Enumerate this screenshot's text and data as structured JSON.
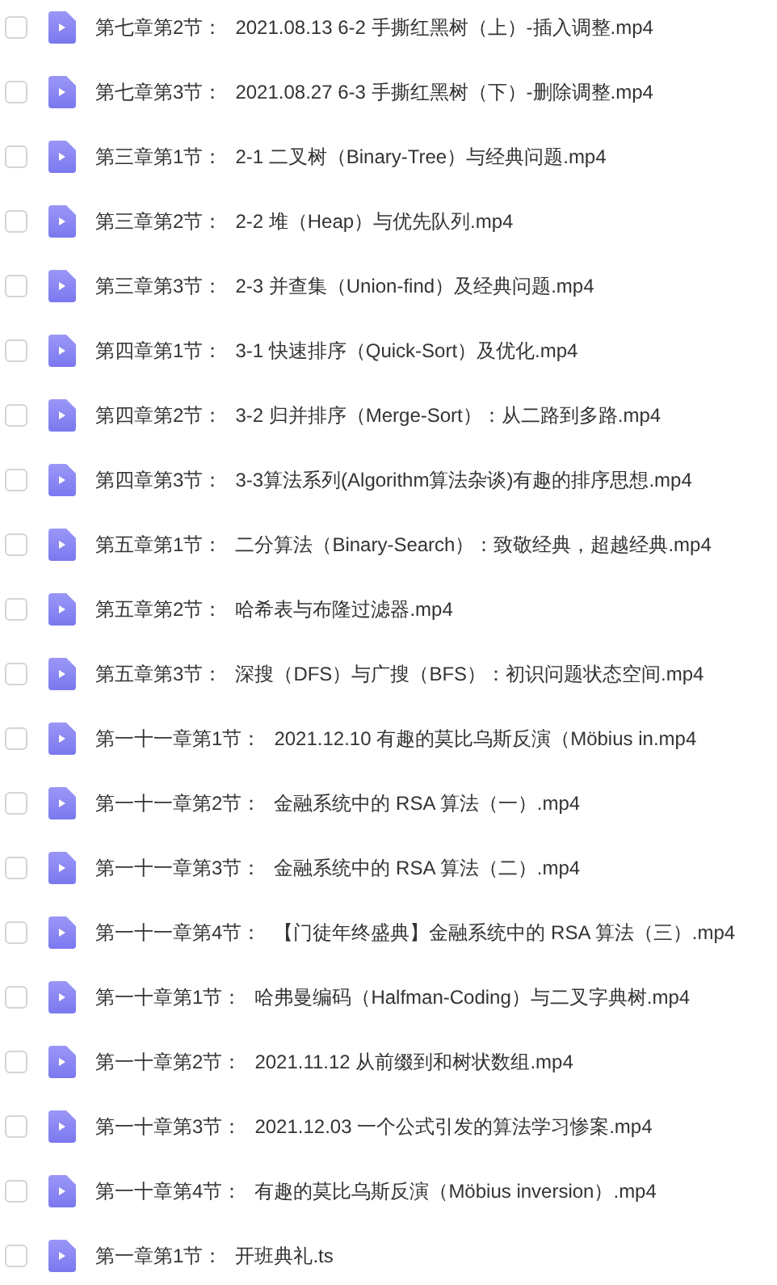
{
  "files": [
    {
      "section": "第七章第2节：",
      "title": "2021.08.13 6-2 手撕红黑树（上）-插入调整.mp4",
      "checked": false
    },
    {
      "section": "第七章第3节：",
      "title": "2021.08.27 6-3 手撕红黑树（下）-删除调整.mp4",
      "checked": false
    },
    {
      "section": "第三章第1节：",
      "title": "2-1 二叉树（Binary-Tree）与经典问题.mp4",
      "checked": false
    },
    {
      "section": "第三章第2节：",
      "title": "2-2 堆（Heap）与优先队列.mp4",
      "checked": false
    },
    {
      "section": "第三章第3节：",
      "title": "2-3 并查集（Union-find）及经典问题.mp4",
      "checked": false
    },
    {
      "section": "第四章第1节：",
      "title": "3-1 快速排序（Quick-Sort）及优化.mp4",
      "checked": false
    },
    {
      "section": "第四章第2节：",
      "title": "3-2 归并排序（Merge-Sort）：从二路到多路.mp4",
      "checked": false
    },
    {
      "section": "第四章第3节：",
      "title": "3-3算法系列(Algorithm算法杂谈)有趣的排序思想.mp4",
      "checked": false
    },
    {
      "section": "第五章第1节：",
      "title": "二分算法（Binary-Search）：致敬经典，超越经典.mp4",
      "checked": false
    },
    {
      "section": "第五章第2节：",
      "title": "哈希表与布隆过滤器.mp4",
      "checked": false
    },
    {
      "section": "第五章第3节：",
      "title": "深搜（DFS）与广搜（BFS）：初识问题状态空间.mp4",
      "checked": false
    },
    {
      "section": "第一十一章第1节：",
      "title": "2021.12.10 有趣的莫比乌斯反演（Möbius in.mp4",
      "checked": false
    },
    {
      "section": "第一十一章第2节：",
      "title": "金融系统中的 RSA 算法（一）.mp4",
      "checked": false
    },
    {
      "section": "第一十一章第3节：",
      "title": "金融系统中的 RSA 算法（二）.mp4",
      "checked": false
    },
    {
      "section": "第一十一章第4节：",
      "title": "【门徒年终盛典】金融系统中的 RSA 算法（三）.mp4",
      "checked": false
    },
    {
      "section": "第一十章第1节：",
      "title": "哈弗曼编码（Halfman-Coding）与二叉字典树.mp4",
      "checked": false
    },
    {
      "section": "第一十章第2节：",
      "title": "2021.11.12 从前缀到和树状数组.mp4",
      "checked": false
    },
    {
      "section": "第一十章第3节：",
      "title": "2021.12.03 一个公式引发的算法学习惨案.mp4",
      "checked": false
    },
    {
      "section": "第一十章第4节：",
      "title": "有趣的莫比乌斯反演（Möbius inversion）.mp4",
      "checked": false
    },
    {
      "section": "第一章第1节：",
      "title": "开班典礼.ts",
      "checked": false
    }
  ]
}
